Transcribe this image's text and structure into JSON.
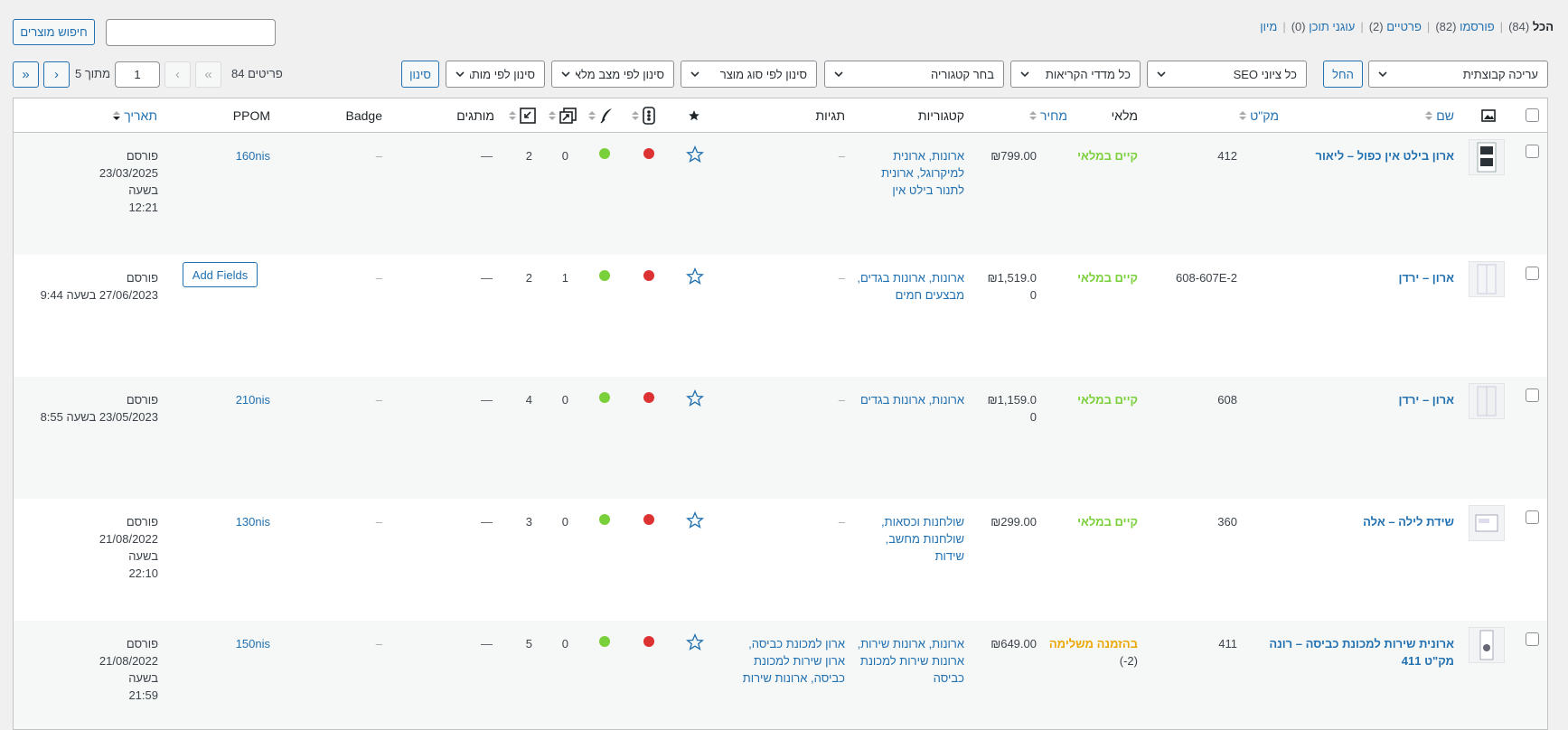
{
  "status_filters": [
    {
      "label": "הכל",
      "count": "(84)",
      "current": true
    },
    {
      "label": "פורסמו",
      "count": "(82)"
    },
    {
      "label": "פרטיים",
      "count": "(2)"
    },
    {
      "label": "עוגני תוכן",
      "count": "(0)"
    },
    {
      "label": "מיון",
      "count": ""
    }
  ],
  "search": {
    "value": "",
    "button": "חיפוש מוצרים"
  },
  "bulk": {
    "selected": "עריכה קבוצתית",
    "apply": "החל"
  },
  "filters": {
    "seo": "כל ציוני SEO",
    "readability": "כל מדדי הקריאות",
    "category": "בחר קטגוריה",
    "product_type": "סינון לפי סוג מוצר",
    "stock": "סינון לפי מצב מלאי",
    "brand": "סינון לפי מותג",
    "filter_button": "סינון"
  },
  "pagination": {
    "items": "84 פריטים",
    "first": "«",
    "prev": "‹",
    "current": "1",
    "of": "מתוך 5",
    "next": "›",
    "last": "»"
  },
  "columns": {
    "name": "שם",
    "sku": "מק\"ט",
    "stock": "מלאי",
    "price": "מחיר",
    "categories": "קטגוריות",
    "tags": "תגיות",
    "brands": "מותגים",
    "badge": "Badge",
    "ppom": "PPOM",
    "date": "תאריך"
  },
  "rows": [
    {
      "name": "ארון בילט אין כפול – ליאור",
      "sku": "412",
      "stock": "קיים במלאי",
      "stock_type": "instock",
      "price": "₪799.00",
      "categories": [
        "ארונות, ארונית",
        "למיקרוגל, ארונית",
        "לתנור בילט אין"
      ],
      "tags": "–",
      "links": "0",
      "linked": "2",
      "brands": "—",
      "badge": "–",
      "ppom": "160nis",
      "status": "פורסם",
      "date": [
        "23/03/2025",
        "בשעה",
        "12:21"
      ]
    },
    {
      "name": "ארון – ירדן",
      "sku": "608-607E-2",
      "stock": "קיים במלאי",
      "stock_type": "instock",
      "price": "₪1,519.0",
      "price2": "0",
      "categories": [
        "ארונות, ארונות בגדים,",
        "מבצעים חמים"
      ],
      "tags": "–",
      "links": "1",
      "linked": "2",
      "brands": "—",
      "badge": "–",
      "ppom_button": "Add Fields",
      "status": "פורסם",
      "date": [
        "27/06/2023 בשעה 9:44"
      ]
    },
    {
      "name": "ארון – ירדן",
      "sku": "608",
      "stock": "קיים במלאי",
      "stock_type": "instock",
      "price": "₪1,159.0",
      "price2": "0",
      "categories": [
        "ארונות, ארונות בגדים"
      ],
      "tags": "–",
      "links": "0",
      "linked": "4",
      "brands": "—",
      "badge": "–",
      "ppom": "210nis",
      "status": "פורסם",
      "date": [
        "23/05/2023 בשעה 8:55"
      ]
    },
    {
      "name": "שידת לילה – אלה",
      "sku": "360",
      "stock": "קיים במלאי",
      "stock_type": "instock",
      "price": "₪299.00",
      "categories": [
        "שולחנות וכסאות,",
        "שולחנות מחשב,",
        "שידות"
      ],
      "tags": "–",
      "links": "0",
      "linked": "3",
      "brands": "—",
      "badge": "–",
      "ppom": "130nis",
      "status": "פורסם",
      "date": [
        "21/08/2022",
        "בשעה",
        "22:10"
      ]
    },
    {
      "name": "ארונית שירות למכונת כביסה – רונה",
      "name2": "מק\"ט 411",
      "sku": "411",
      "stock": "בהזמנה משלימה",
      "stock_note": "(2-)",
      "stock_type": "backorder",
      "price": "₪649.00",
      "categories": [
        "ארונות, ארונות שירות,",
        "ארונות שירות למכונת",
        "כביסה"
      ],
      "tags": "ארון למכונת כביסה,",
      "tags2": "ארון שירות למכונת",
      "tags3": "כביסה, ארונות שירות",
      "links": "0",
      "linked": "5",
      "brands": "—",
      "badge": "–",
      "ppom": "150nis",
      "status": "פורסם",
      "date": [
        "21/08/2022",
        "בשעה",
        "21:59"
      ]
    }
  ]
}
